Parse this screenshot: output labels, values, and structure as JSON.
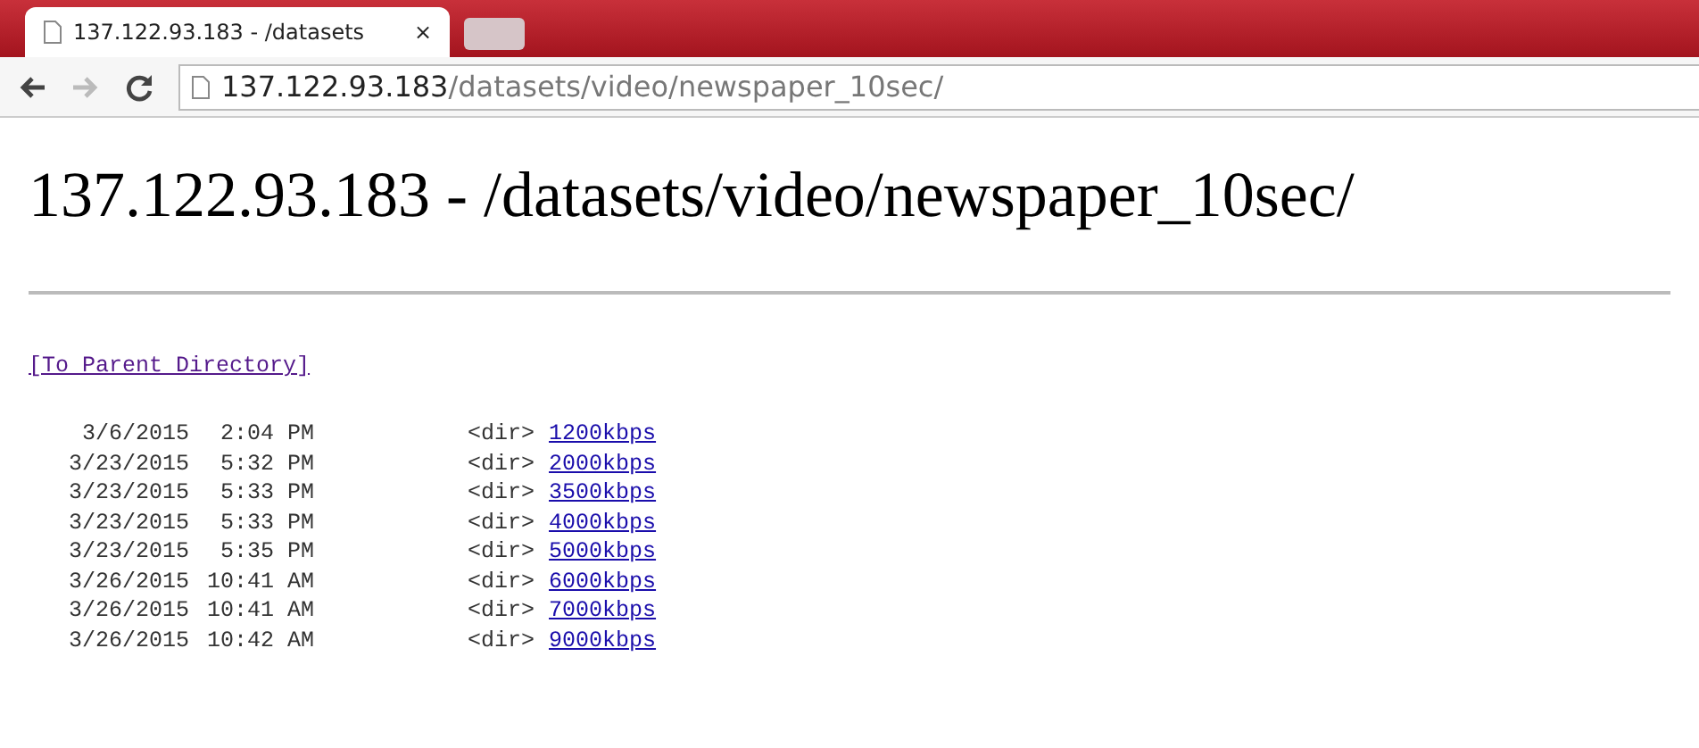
{
  "browser": {
    "tab": {
      "title": "137.122.93.183 - /datasets",
      "close": "×",
      "selected": true
    },
    "address": {
      "host": "137.122.93.183",
      "path": "/datasets/video/newspaper_10sec/"
    }
  },
  "page": {
    "heading": "137.122.93.183 - /datasets/video/newspaper_10sec/",
    "parent_link": "[To Parent Directory]",
    "entries": [
      {
        "date": "3/6/2015",
        "time": "2:04 PM",
        "type": "<dir>",
        "name": "1200kbps"
      },
      {
        "date": "3/23/2015",
        "time": "5:32 PM",
        "type": "<dir>",
        "name": "2000kbps"
      },
      {
        "date": "3/23/2015",
        "time": "5:33 PM",
        "type": "<dir>",
        "name": "3500kbps"
      },
      {
        "date": "3/23/2015",
        "time": "5:33 PM",
        "type": "<dir>",
        "name": "4000kbps"
      },
      {
        "date": "3/23/2015",
        "time": "5:35 PM",
        "type": "<dir>",
        "name": "5000kbps"
      },
      {
        "date": "3/26/2015",
        "time": "10:41 AM",
        "type": "<dir>",
        "name": "6000kbps"
      },
      {
        "date": "3/26/2015",
        "time": "10:41 AM",
        "type": "<dir>",
        "name": "7000kbps"
      },
      {
        "date": "3/26/2015",
        "time": "10:42 AM",
        "type": "<dir>",
        "name": "9000kbps"
      }
    ]
  }
}
